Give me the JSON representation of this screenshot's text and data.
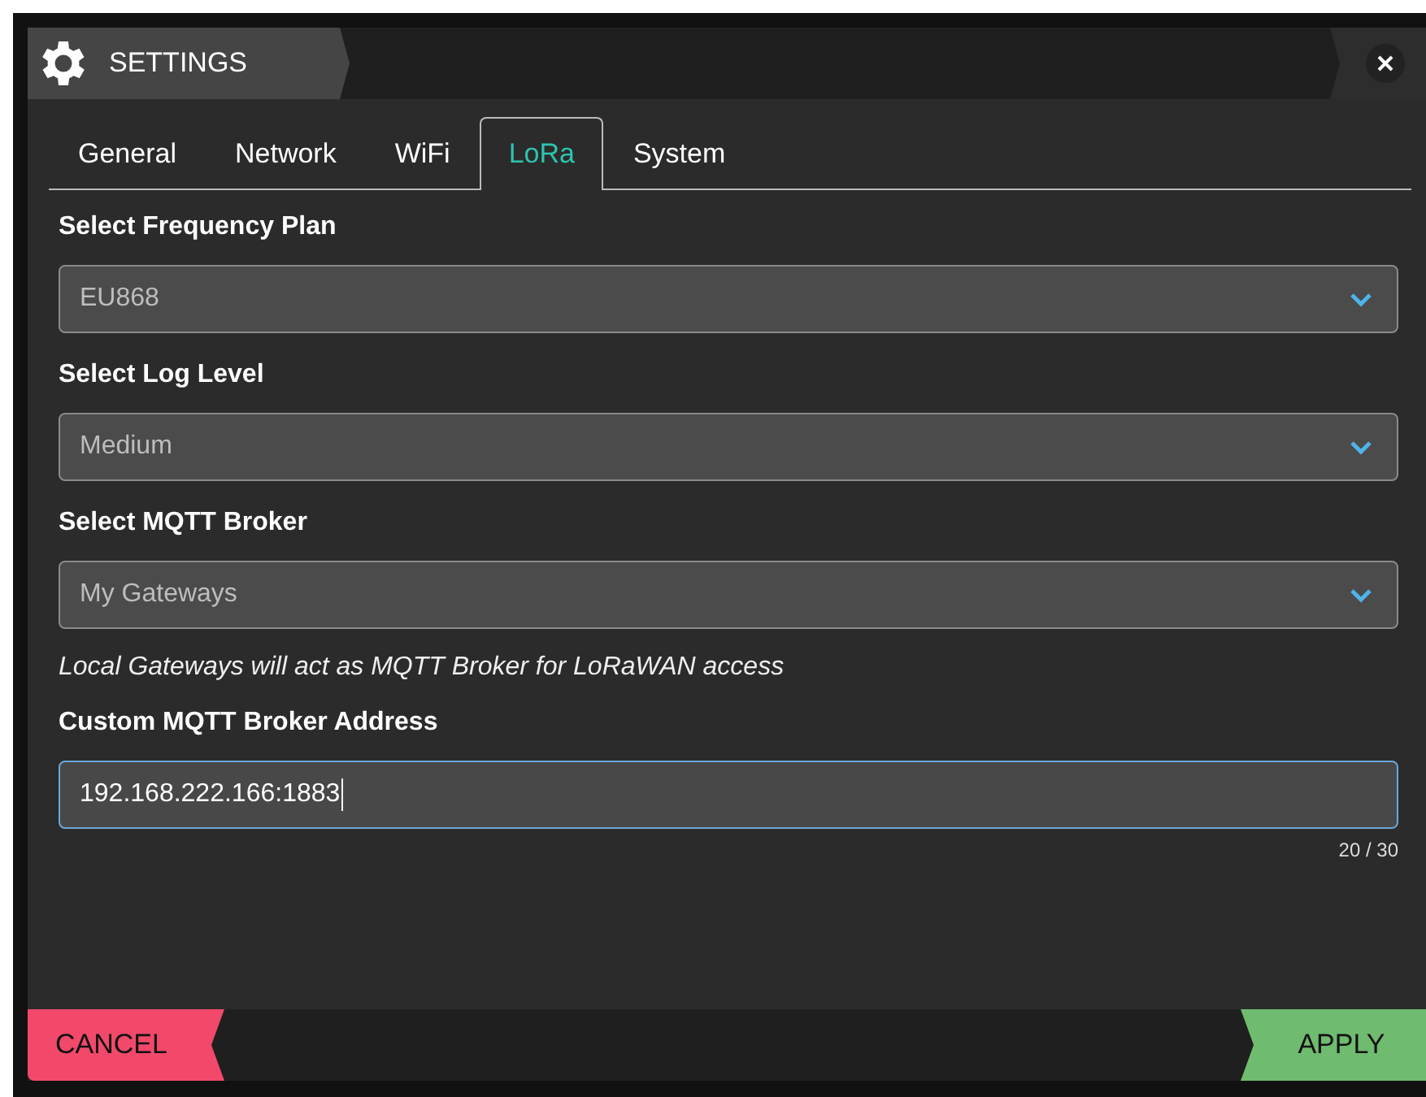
{
  "window": {
    "title": "SETTINGS"
  },
  "tabs": [
    {
      "label": "General",
      "selected": false
    },
    {
      "label": "Network",
      "selected": false
    },
    {
      "label": "WiFi",
      "selected": false
    },
    {
      "label": "LoRa",
      "selected": true
    },
    {
      "label": "System",
      "selected": false
    }
  ],
  "fields": [
    {
      "kind": "select",
      "label": "Select Frequency Plan",
      "value": "EU868"
    },
    {
      "kind": "select",
      "label": "Select Log Level",
      "value": "Medium"
    },
    {
      "kind": "select",
      "label": "Select MQTT Broker",
      "value": "My Gateways"
    },
    {
      "kind": "note",
      "text": "Local Gateways will act as MQTT Broker for LoRaWAN access"
    },
    {
      "kind": "text",
      "label": "Custom MQTT Broker Address",
      "value": "192.168.222.166:1883",
      "counter": "20 / 30",
      "focused": true
    }
  ],
  "buttons": {
    "cancel": "CANCEL",
    "apply": "APPLY"
  }
}
